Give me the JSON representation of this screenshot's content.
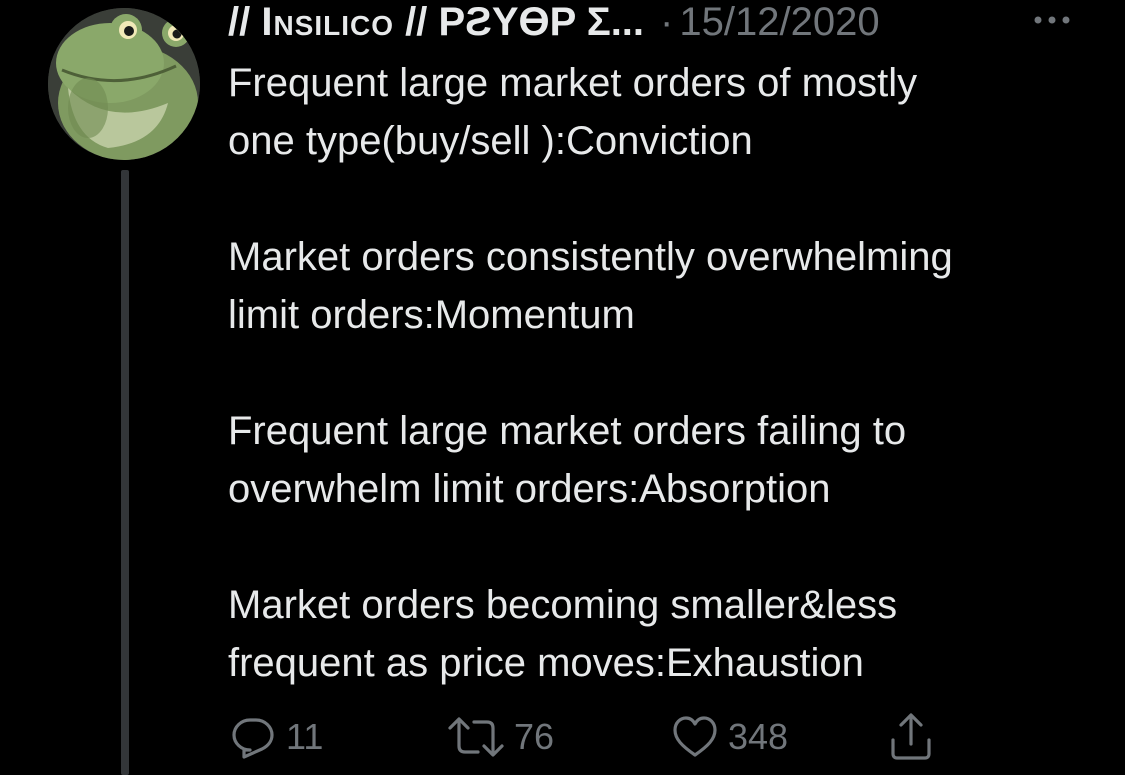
{
  "tweet": {
    "display_name_prefix": "// ",
    "display_name_smallcaps": "Insilico",
    "display_name_suffix": " // PƧYӨP Σ...",
    "separator": "·",
    "timestamp": "15/12/2020",
    "more_icon": "more-horizontal-icon",
    "paragraphs": [
      {
        "lines": [
          "Frequent large market orders of mostly",
          "one type(buy/sell ):Conviction"
        ]
      },
      {
        "lines": [
          "Market orders consistently overwhelming",
          "limit orders:Momentum"
        ]
      },
      {
        "lines": [
          "Frequent large market orders failing to",
          "overwhelm limit orders:Absorption"
        ]
      },
      {
        "lines": [
          "Market orders becoming smaller&less",
          "frequent as price moves:Exhaustion"
        ]
      }
    ]
  },
  "actions": {
    "reply_count": "11",
    "retweet_count": "76",
    "like_count": "348",
    "icons": {
      "reply": "reply-icon",
      "retweet": "retweet-icon",
      "like": "heart-icon",
      "share": "share-icon"
    }
  },
  "colors": {
    "background": "#000000",
    "text": "#e7e9ea",
    "secondary": "#71767b",
    "thread_line": "#333639"
  }
}
